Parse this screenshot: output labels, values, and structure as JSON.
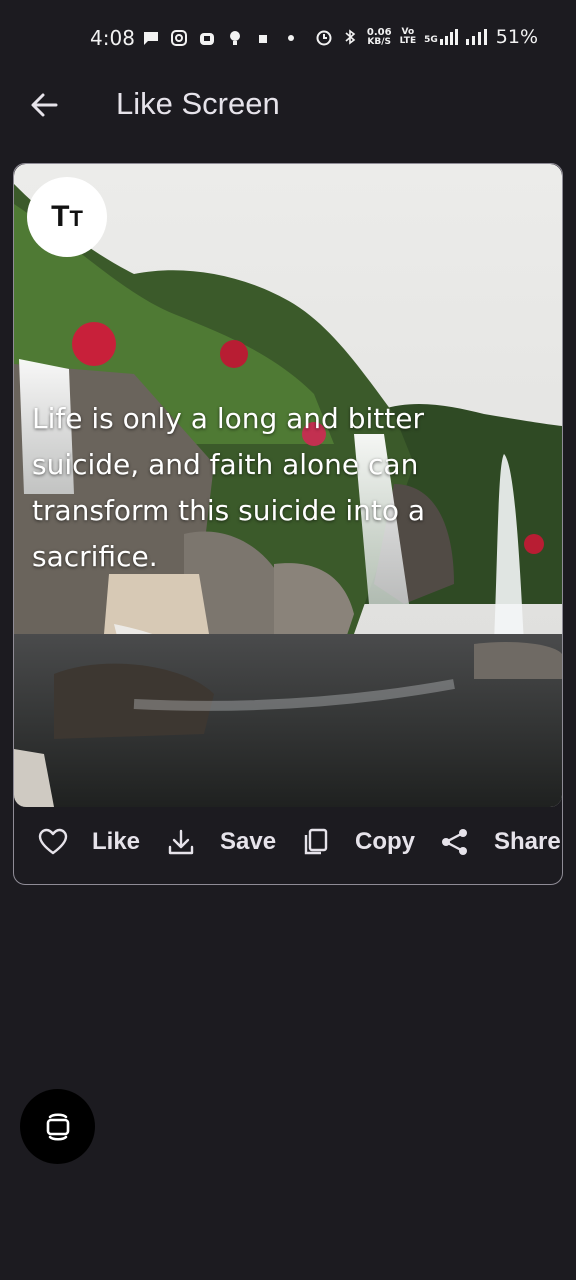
{
  "status_bar": {
    "time": "4:08",
    "speed_value": "0.06",
    "speed_unit": "KB/S",
    "volte_top": "Vo",
    "volte_bottom": "LTE",
    "network": "5G",
    "battery": "51%"
  },
  "app_bar": {
    "title": "Like Screen"
  },
  "card": {
    "font_button_label": "TT",
    "quote": "Life is only a long and bitter suicide, and faith alone can transform this suicide into a sacrifice.",
    "actions": {
      "like": "Like",
      "save": "Save",
      "copy": "Copy",
      "share": "Share"
    }
  },
  "colors": {
    "background": "#1c1b20",
    "text": "#e6e3ea",
    "card_border": "#8f8c96"
  },
  "icons": [
    "arrow-back-icon",
    "heart-icon",
    "download-icon",
    "copy-icon",
    "share-icon",
    "text-format-icon",
    "screen-rotate-icon"
  ]
}
